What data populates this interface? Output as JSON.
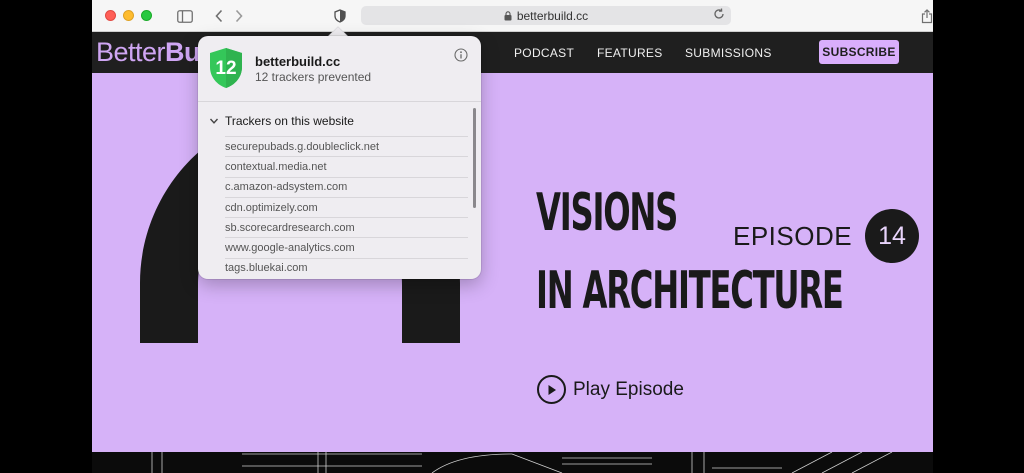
{
  "browser": {
    "address": "betterbuild.cc"
  },
  "site": {
    "logo_light": "Better",
    "logo_bold": "Bu",
    "nav": [
      "PODCAST",
      "FEATURES",
      "SUBMISSIONS"
    ],
    "subscribe": "SUBSCRIBE"
  },
  "hero": {
    "title_line1": "VISIONS",
    "title_line2": "IN ARCHITECTURE",
    "episode_label": "EPISODE",
    "episode_number": "14",
    "play_label": "Play Episode"
  },
  "privacy_report": {
    "badge_count": "12",
    "site": "betterbuild.cc",
    "summary": "12 trackers prevented",
    "section_title": "Trackers on this website",
    "trackers": [
      "securepubads.g.doubleclick.net",
      "contextual.media.net",
      "c.amazon-adsystem.com",
      "cdn.optimizely.com",
      "sb.scorecardresearch.com",
      "www.google-analytics.com",
      "tags.bluekai.com"
    ]
  },
  "icons": {
    "sidebar": "sidebar-icon",
    "back": "chevron-left-icon",
    "forward": "chevron-right-icon",
    "privacy": "shield-icon",
    "lock": "lock-icon",
    "reload": "reload-icon",
    "share": "share-icon",
    "info": "info-icon",
    "disclosure": "chevron-down-icon",
    "play": "play-icon"
  },
  "colors": {
    "hero_background": "#d6b2f8",
    "nav_background": "#1f1f1f",
    "subscribe_background": "#d9aefc",
    "shield_green": "#34c759"
  }
}
